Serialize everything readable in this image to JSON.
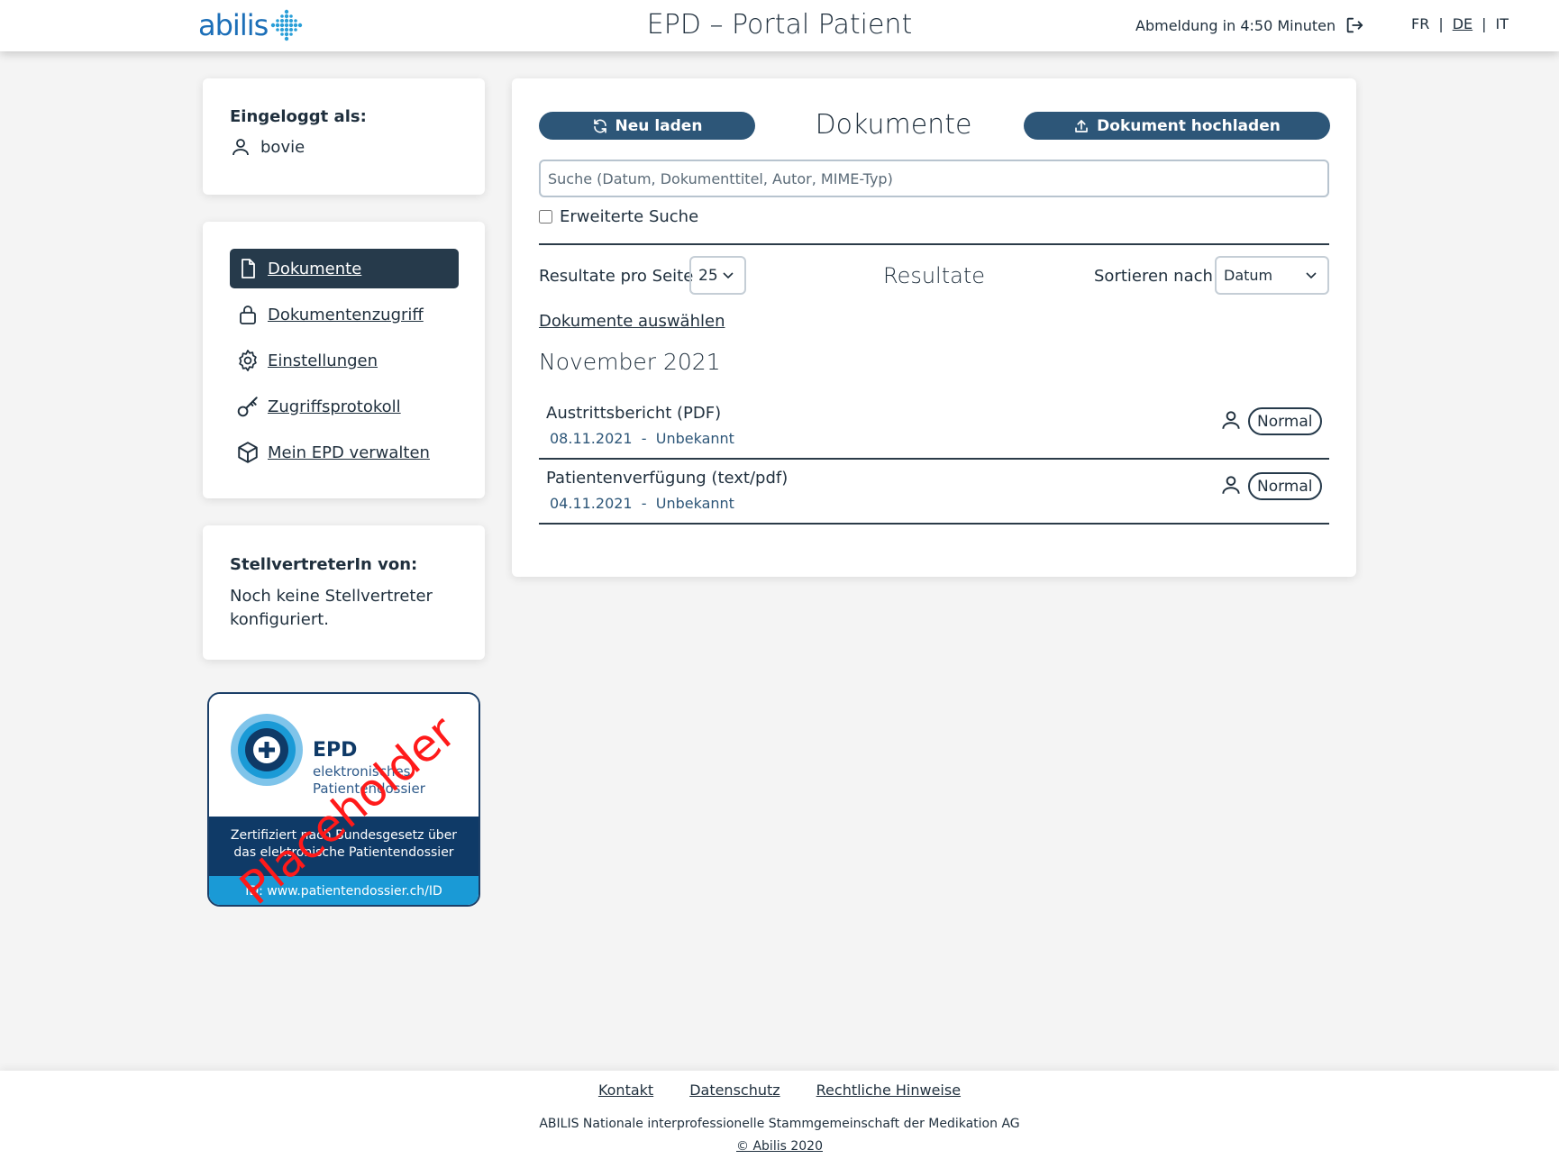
{
  "header": {
    "logo_text": "abilis",
    "title": "EPD – Portal Patient",
    "logout_text": "Abmeldung in 4:50 Minuten",
    "languages": [
      {
        "label": "FR",
        "active": false
      },
      {
        "label": "DE",
        "active": true
      },
      {
        "label": "IT",
        "active": false
      }
    ],
    "lang_sep": "|"
  },
  "login": {
    "label": "Eingeloggt als:",
    "username": "bovie"
  },
  "nav": {
    "items": [
      {
        "label": "Dokumente",
        "icon": "document-icon",
        "active": true
      },
      {
        "label": "Dokumentenzugriff",
        "icon": "lock-icon",
        "active": false
      },
      {
        "label": "Einstellungen",
        "icon": "gear-icon",
        "active": false
      },
      {
        "label": "Zugriffsprotokoll",
        "icon": "key-icon",
        "active": false
      },
      {
        "label": "Mein EPD verwalten",
        "icon": "box-icon",
        "active": false
      }
    ]
  },
  "representative": {
    "label": "StellvertreterIn von:",
    "text": "Noch keine Stellvertreter konfiguriert."
  },
  "badge": {
    "title": "EPD",
    "subtitle_line1": "elektronisches",
    "subtitle_line2": "Patientendossier",
    "cert_line1": "Zertifiziert nach Bundesgesetz über",
    "cert_line2": "das elektronische Patientendossier",
    "id_text": "ID: www.patientendossier.ch/ID",
    "overlay": "Placeholder"
  },
  "main": {
    "reload_label": "Neu laden",
    "title": "Dokumente",
    "upload_label": "Dokument hochladen",
    "search_placeholder": "Suche (Datum, Dokumenttitel, Autor, MIME-Typ)",
    "advanced_search_label": "Erweiterte Suche",
    "results_per_page_label": "Resultate pro Seite",
    "results_per_page_value": "25",
    "results_title": "Resultate",
    "sort_label": "Sortieren nach",
    "sort_value": "Datum",
    "select_documents_label": "Dokumente auswählen",
    "month_heading": "November 2021",
    "documents": [
      {
        "title": "Austrittsbericht (PDF)",
        "date": "08.11.2021",
        "sep": "-",
        "author": "Unbekannt",
        "confidentiality": "Normal"
      },
      {
        "title": "Patientenverfügung (text/pdf)",
        "date": "04.11.2021",
        "sep": "-",
        "author": "Unbekannt",
        "confidentiality": "Normal"
      }
    ]
  },
  "footer": {
    "links": [
      "Kontakt",
      "Datenschutz",
      "Rechtliche Hinweise"
    ],
    "org": "ABILIS Nationale interprofessionelle Stammgemeinschaft der Medikation AG",
    "copyright": "© Abilis 2020"
  },
  "colors": {
    "primary": "#2d5678",
    "nav_active": "#263a4b",
    "logo_blue": "#1c6fb8",
    "badge_dark": "#0f3a67",
    "badge_light": "#1a9ad6",
    "placeholder_red": "#ff1a1a"
  }
}
